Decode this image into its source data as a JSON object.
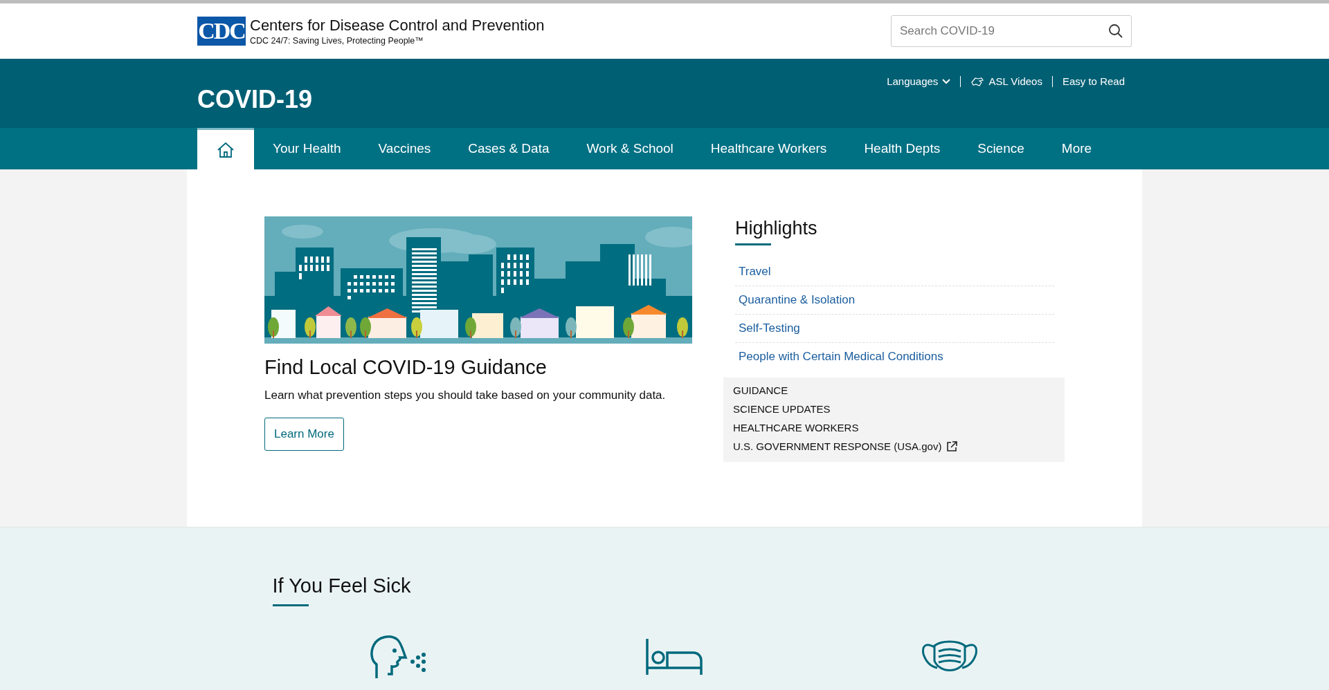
{
  "header": {
    "logo_text": "CDC",
    "org_name": "Centers for Disease Control and Prevention",
    "tagline": "CDC 24/7: Saving Lives, Protecting People™",
    "search": {
      "placeholder": "Search COVID-19"
    }
  },
  "banner": {
    "title": "COVID-19",
    "links": [
      {
        "label": "Languages",
        "kind": "dropdown"
      },
      {
        "label": "ASL Videos",
        "kind": "asl"
      },
      {
        "label": "Easy to Read",
        "kind": "plain"
      }
    ]
  },
  "nav": {
    "items": [
      {
        "kind": "home",
        "selected": true
      },
      {
        "label": "Your Health",
        "kind": "text",
        "selected": false
      },
      {
        "label": "Vaccines",
        "kind": "text",
        "selected": false
      },
      {
        "label": "Cases & Data",
        "kind": "text",
        "selected": false
      },
      {
        "label": "Work & School",
        "kind": "text",
        "selected": false
      },
      {
        "label": "Healthcare Workers",
        "kind": "text",
        "selected": false
      },
      {
        "label": "Health Depts",
        "kind": "text",
        "selected": false
      },
      {
        "label": "Science",
        "kind": "text",
        "selected": false
      },
      {
        "label": "More",
        "kind": "text",
        "selected": false
      }
    ]
  },
  "feature": {
    "heading": "Find Local COVID-19 Guidance",
    "text": "Learn what prevention steps you should take based on your community data.",
    "button": "Learn More"
  },
  "highlights": {
    "title": "Highlights",
    "links": [
      "Travel",
      "Quarantine & Isolation",
      "Self-Testing",
      "People with Certain Medical Conditions"
    ],
    "quick_links": [
      {
        "label": "GUIDANCE",
        "external": false
      },
      {
        "label": "SCIENCE UPDATES",
        "external": false
      },
      {
        "label": "HEALTHCARE WORKERS",
        "external": false
      },
      {
        "label": "U.S. GOVERNMENT RESPONSE (USA.gov)",
        "external": true
      }
    ]
  },
  "sick_section": {
    "title": "If You Feel Sick"
  }
}
